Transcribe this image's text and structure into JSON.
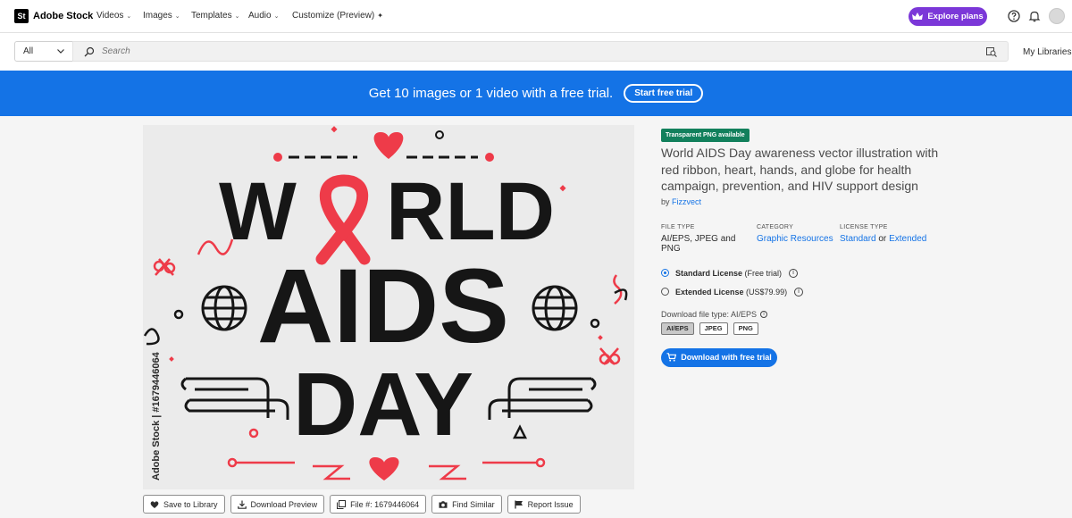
{
  "nav": {
    "logo_mark": "St",
    "logo_text": "Adobe Stock",
    "items": [
      "Videos",
      "Images",
      "Templates",
      "Audio"
    ],
    "customize": "Customize (Preview)",
    "explore_label": "Explore plans"
  },
  "search": {
    "category": "All",
    "placeholder": "Search",
    "libraries": "My Libraries"
  },
  "banner": {
    "text": "Get 10 images or 1 video with a free trial.",
    "button": "Start free trial"
  },
  "preview": {
    "headline_1": "W",
    "headline_1b": "RLD",
    "headline_2": "AIDS",
    "headline_3": "DAY",
    "watermark": "Adobe Stock | #1679446064",
    "accent": "#ee3b49",
    "ink": "#161616"
  },
  "actions": {
    "save": "Save to Library",
    "download": "Download Preview",
    "file": "File #: 1679446064",
    "similar": "Find Similar",
    "report": "Report Issue"
  },
  "asset": {
    "badge": "Transparent PNG available",
    "title": "World AIDS Day awareness vector illustration with red ribbon, heart, hands, and globe for health campaign, prevention, and HIV support design",
    "by_prefix": "by",
    "author": "Fizzvect",
    "file_type_label": "FILE TYPE",
    "file_type": "AI/EPS, JPEG and PNG",
    "category_label": "CATEGORY",
    "category": "Graphic Resources",
    "license_label": "LICENSE TYPE",
    "license_standard": "Standard",
    "license_or": "or",
    "license_extended": "Extended",
    "standard_license": "Standard License",
    "standard_note": "(Free trial)",
    "extended_license": "Extended License",
    "extended_note": "(US$79.99)",
    "download_type": "Download file type: AI/EPS",
    "formats": [
      "AI/EPS",
      "JPEG",
      "PNG"
    ],
    "download_button": "Download with free trial"
  }
}
